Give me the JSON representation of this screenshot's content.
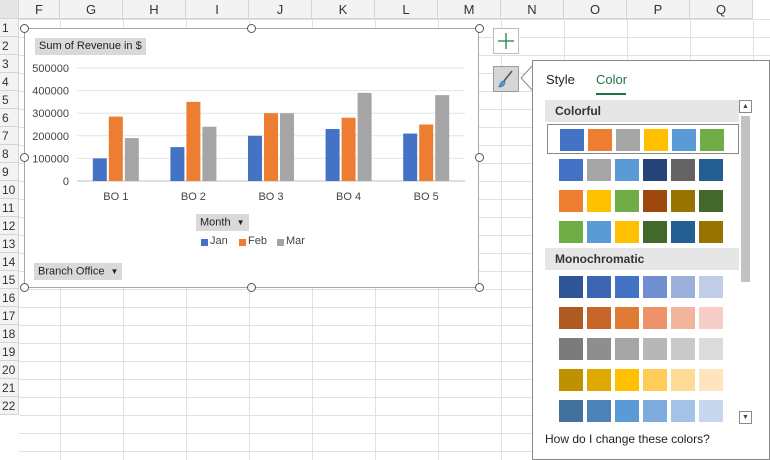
{
  "columns": [
    "F",
    "G",
    "H",
    "I",
    "J",
    "K",
    "L",
    "M",
    "N",
    "O",
    "P",
    "Q"
  ],
  "rows": [
    "1",
    "2",
    "3",
    "4",
    "5",
    "6",
    "7",
    "8",
    "9",
    "10",
    "11",
    "12",
    "13",
    "14",
    "15",
    "16",
    "17",
    "18",
    "19",
    "20",
    "21",
    "22"
  ],
  "pivot_buttons": {
    "value_field": "Sum of Revenue in $",
    "legend_field": "Month",
    "axis_field": "Branch Office"
  },
  "chart_data": {
    "type": "bar",
    "title": "",
    "categories": [
      "BO 1",
      "BO 2",
      "BO 3",
      "BO 4",
      "BO 5"
    ],
    "series": [
      {
        "name": "Jan",
        "color": "#4472C4",
        "values": [
          100000,
          150000,
          200000,
          230000,
          210000
        ]
      },
      {
        "name": "Feb",
        "color": "#ED7D31",
        "values": [
          285000,
          350000,
          300000,
          280000,
          250000
        ]
      },
      {
        "name": "Mar",
        "color": "#A5A5A5",
        "values": [
          190000,
          240000,
          300000,
          390000,
          380000
        ]
      }
    ],
    "yticks": [
      0,
      100000,
      200000,
      300000,
      400000,
      500000
    ],
    "ylim": [
      0,
      500000
    ],
    "legend_position": "bottom",
    "grid": true
  },
  "side_buttons": {
    "add_icon": "plus-icon",
    "style_icon": "paintbrush-icon"
  },
  "pane": {
    "tabs": [
      {
        "label": "Style",
        "active": false
      },
      {
        "label": "Color",
        "active": true
      }
    ],
    "sections": [
      {
        "title": "Colorful",
        "rows": [
          [
            "#4472C4",
            "#ED7D31",
            "#A5A5A5",
            "#FFC000",
            "#5B9BD5",
            "#70AD47"
          ],
          [
            "#4472C4",
            "#A5A5A5",
            "#5B9BD5",
            "#264478",
            "#636363",
            "#255E91"
          ],
          [
            "#ED7D31",
            "#FFC000",
            "#70AD47",
            "#9E480E",
            "#997300",
            "#43682B"
          ],
          [
            "#70AD47",
            "#5B9BD5",
            "#FFC000",
            "#43682B",
            "#255E91",
            "#997300"
          ]
        ]
      },
      {
        "title": "Monochromatic",
        "rows": [
          [
            "#2F5597",
            "#3E64B4",
            "#4472C4",
            "#6F8FD0",
            "#9BB0DB",
            "#C1CDE7"
          ],
          [
            "#AE5A21",
            "#C96528",
            "#E07B36",
            "#EE9369",
            "#F2B49B",
            "#F7CEC6"
          ],
          [
            "#7B7B7B",
            "#8E8E8E",
            "#A5A5A5",
            "#B7B7B7",
            "#C9C9C9",
            "#DBDBDB"
          ],
          [
            "#BF9000",
            "#DEA900",
            "#FFC000",
            "#FFCD57",
            "#FFD996",
            "#FFE4BE"
          ],
          [
            "#41719C",
            "#4C82B8",
            "#5B9BD5",
            "#7EAADC",
            "#A4C2E5",
            "#C7D8EE"
          ]
        ]
      }
    ],
    "selected_row": "0.0",
    "help_text": "How do I change these colors?"
  }
}
